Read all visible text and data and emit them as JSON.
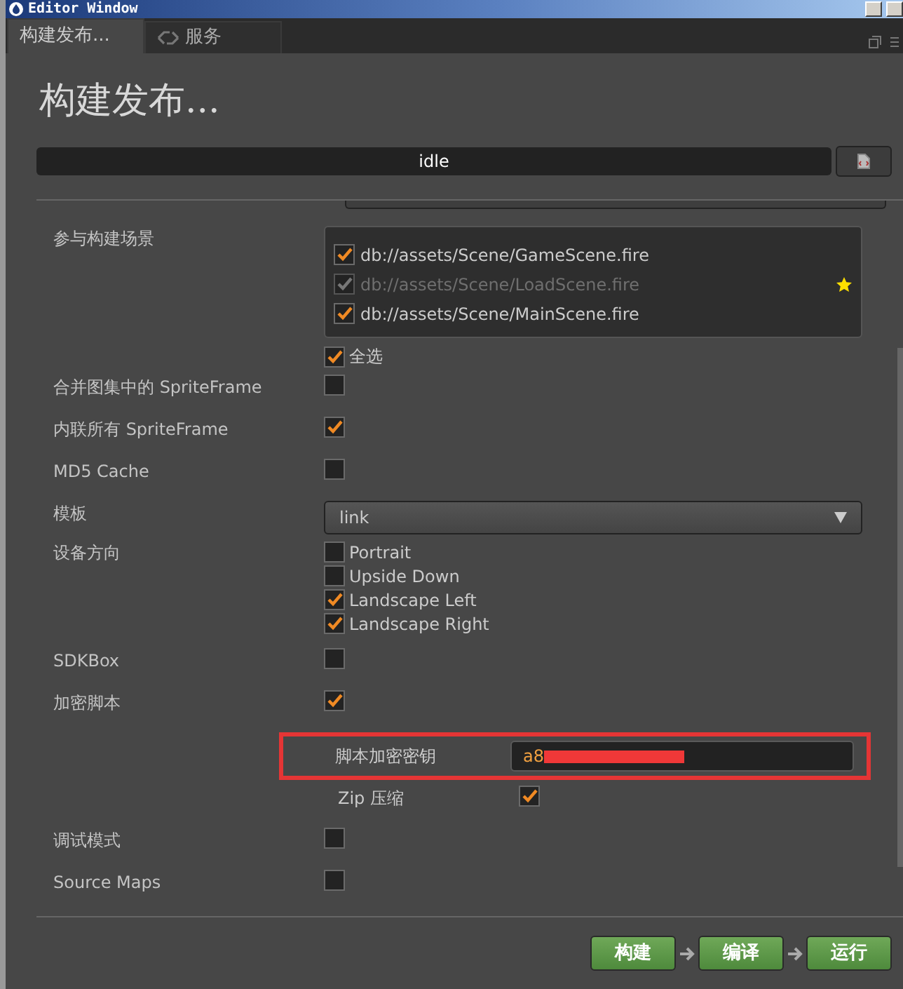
{
  "window": {
    "title": "Editor Window"
  },
  "tabs": [
    {
      "label": "构建发布...",
      "selected": true
    },
    {
      "label": "服务",
      "selected": false
    }
  ],
  "heading": "构建发布...",
  "status_bar": {
    "text": "idle"
  },
  "scenes": {
    "label": "参与构建场景",
    "items": [
      {
        "path": "db://assets/Scene/GameScene.fire",
        "checked": true,
        "disabled": false,
        "starred": false
      },
      {
        "path": "db://assets/Scene/LoadScene.fire",
        "checked": true,
        "disabled": true,
        "starred": true
      },
      {
        "path": "db://assets/Scene/MainScene.fire",
        "checked": true,
        "disabled": false,
        "starred": false
      }
    ],
    "select_all": {
      "label": "全选",
      "checked": true
    }
  },
  "settings": [
    {
      "kind": "checkbox",
      "label": "合并图集中的 SpriteFrame",
      "checked": false
    },
    {
      "kind": "checkbox",
      "label": "内联所有 SpriteFrame",
      "checked": true
    },
    {
      "kind": "checkbox",
      "label": "MD5 Cache",
      "checked": false
    },
    {
      "kind": "select",
      "label": "模板",
      "value": "link"
    },
    {
      "kind": "options",
      "label": "设备方向",
      "options": [
        {
          "label": "Portrait",
          "checked": false
        },
        {
          "label": "Upside Down",
          "checked": false
        },
        {
          "label": "Landscape Left",
          "checked": true
        },
        {
          "label": "Landscape Right",
          "checked": true
        }
      ]
    },
    {
      "kind": "checkbox",
      "label": "SDKBox",
      "checked": false
    },
    {
      "kind": "checkbox",
      "label": "加密脚本",
      "checked": true
    },
    {
      "kind": "key",
      "label": "脚本加密密钥",
      "value": "a8",
      "highlighted": true,
      "redacted": true
    },
    {
      "kind": "subcheck",
      "label": "Zip 压缩",
      "checked": true
    },
    {
      "kind": "checkbox",
      "label": "调试模式",
      "checked": false
    },
    {
      "kind": "checkbox",
      "label": "Source Maps",
      "checked": false
    }
  ],
  "buttons": [
    {
      "label": "构建"
    },
    {
      "label": "编译"
    },
    {
      "label": "运行"
    }
  ]
}
